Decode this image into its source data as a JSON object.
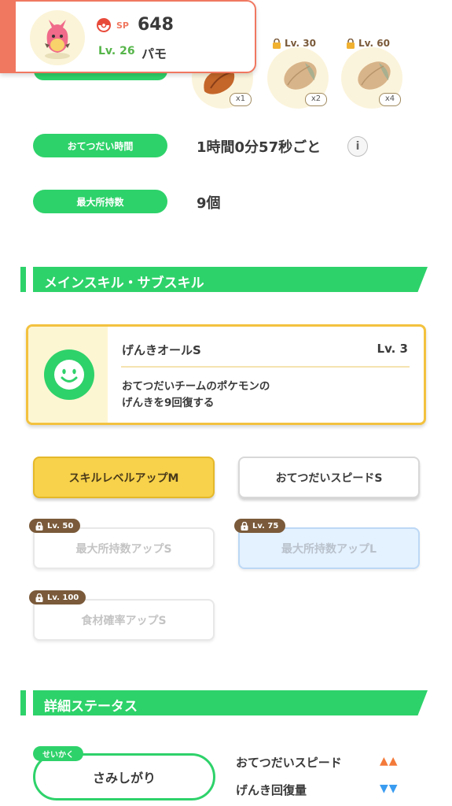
{
  "header": {
    "sp_label": "SP",
    "sp_value": "648",
    "level": "Lv. 26",
    "pokemon_name": "パモ"
  },
  "ingredients": [
    {
      "lock": "",
      "multiplier": "x1"
    },
    {
      "lock": "Lv. 30",
      "multiplier": "x2"
    },
    {
      "lock": "Lv. 60",
      "multiplier": "x4"
    }
  ],
  "stats": {
    "help_time_label": "おてつだい時間",
    "help_time_value": "1時間0分57秒ごと",
    "info_icon": "i",
    "max_carry_label": "最大所持数",
    "max_carry_value": "9個"
  },
  "skills_section": {
    "title": "メインスキル・サブスキル",
    "main_skill": {
      "name": "げんきオールS",
      "level": "Lv. 3",
      "description_line1": "おてつだいチームのポケモンの",
      "description_line2": "げんきを9回復する"
    },
    "sub_skills": [
      {
        "label": "スキルレベルアップM",
        "lock": ""
      },
      {
        "label": "おてつだいスピードS",
        "lock": ""
      },
      {
        "label": "最大所持数アップS",
        "lock": "Lv. 50"
      },
      {
        "label": "最大所持数アップL",
        "lock": "Lv. 75"
      },
      {
        "label": "食材確率アップS",
        "lock": "Lv. 100"
      }
    ]
  },
  "details_section": {
    "title": "詳細ステータス",
    "nature_tag": "せいかく",
    "nature_value": "さみしがり",
    "effect_up_label": "おてつだいスピード",
    "effect_up_arrows": "▲▲",
    "effect_down_label": "げんき回復量",
    "effect_down_arrows": "▼▼"
  },
  "colors": {
    "accent_green": "#2ed26a",
    "header_accent": "#f07860",
    "gold": "#f3c23e",
    "up_arrow": "#f37a3a",
    "down_arrow": "#3a9cf0"
  }
}
